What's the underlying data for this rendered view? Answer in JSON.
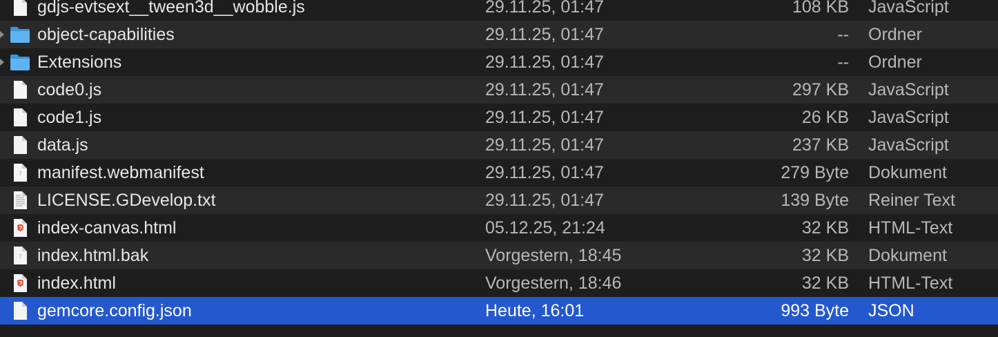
{
  "files": [
    {
      "name": "gdjs-evtsext__tween3d__wobble.js",
      "date": "29.11.25, 01:47",
      "size": "108 KB",
      "kind": "JavaScript",
      "icon": "document-icon",
      "folder": false
    },
    {
      "name": "object-capabilities",
      "date": "29.11.25, 01:47",
      "size": "--",
      "kind": "Ordner",
      "icon": "folder-icon",
      "folder": true
    },
    {
      "name": "Extensions",
      "date": "29.11.25, 01:47",
      "size": "--",
      "kind": "Ordner",
      "icon": "folder-icon",
      "folder": true
    },
    {
      "name": "code0.js",
      "date": "29.11.25, 01:47",
      "size": "297 KB",
      "kind": "JavaScript",
      "icon": "document-icon",
      "folder": false
    },
    {
      "name": "code1.js",
      "date": "29.11.25, 01:47",
      "size": "26 KB",
      "kind": "JavaScript",
      "icon": "document-icon",
      "folder": false
    },
    {
      "name": "data.js",
      "date": "29.11.25, 01:47",
      "size": "237 KB",
      "kind": "JavaScript",
      "icon": "document-icon",
      "folder": false
    },
    {
      "name": "manifest.webmanifest",
      "date": "29.11.25, 01:47",
      "size": "279 Byte",
      "kind": "Dokument",
      "icon": "generic-document-icon",
      "folder": false
    },
    {
      "name": "LICENSE.GDevelop.txt",
      "date": "29.11.25, 01:47",
      "size": "139 Byte",
      "kind": "Reiner Text",
      "icon": "text-document-icon",
      "folder": false
    },
    {
      "name": "index-canvas.html",
      "date": "05.12.25, 21:24",
      "size": "32 KB",
      "kind": "HTML-Text",
      "icon": "html-document-icon",
      "folder": false
    },
    {
      "name": "index.html.bak",
      "date": "Vorgestern, 18:45",
      "size": "32 KB",
      "kind": "Dokument",
      "icon": "generic-document-icon",
      "folder": false
    },
    {
      "name": "index.html",
      "date": "Vorgestern, 18:46",
      "size": "32 KB",
      "kind": "HTML-Text",
      "icon": "html-document-icon",
      "folder": false
    },
    {
      "name": "gemcore.config.json",
      "date": "Heute, 16:01",
      "size": "993 Byte",
      "kind": "JSON",
      "icon": "document-icon",
      "folder": false,
      "selected": true
    }
  ],
  "colors": {
    "selection": "#2458cf",
    "folder": "#5eb3f2",
    "background": "#1e1e1e",
    "alt_row": "#2a2a2a"
  }
}
